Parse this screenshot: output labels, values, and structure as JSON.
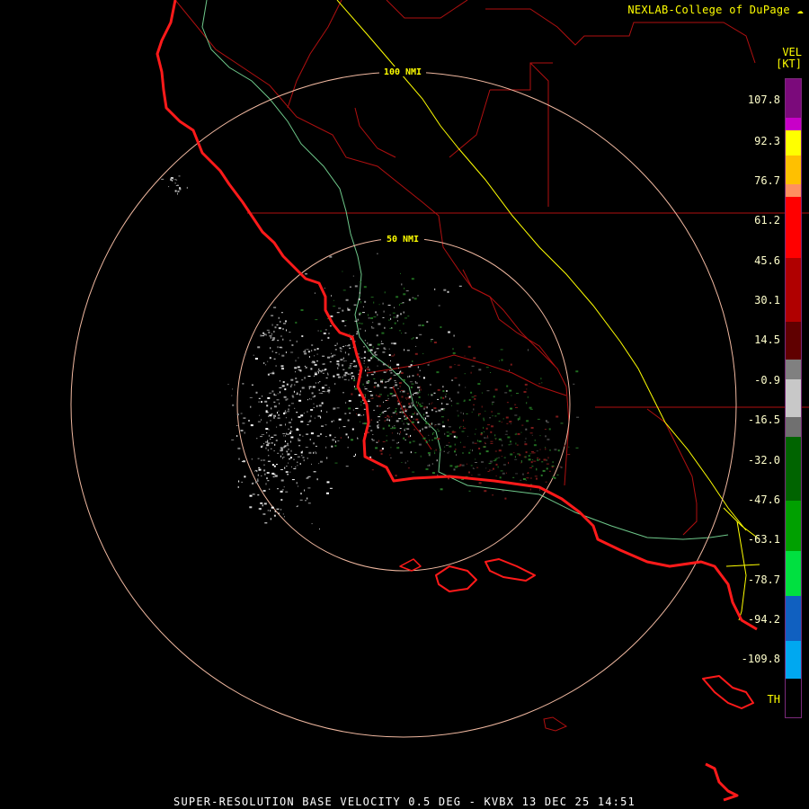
{
  "credit": "NEXLAB-College of DuPage",
  "product_footer": "SUPER-RESOLUTION BASE VELOCITY 0.5 DEG - KVBX 13 DEC 25 14:51",
  "legend": {
    "header_line1": "VEL",
    "header_line2": "[KT]",
    "ticks": [
      "107.8",
      "92.3",
      "76.7",
      "61.2",
      "45.6",
      "30.1",
      "14.5",
      "-0.9",
      "-16.5",
      "-32.0",
      "-47.6",
      "-63.1",
      "-78.7",
      "-94.2",
      "-109.8",
      "TH"
    ],
    "segments": [
      {
        "from": 0.0,
        "to": 0.06,
        "color": "#7b0a7b"
      },
      {
        "from": 0.06,
        "to": 0.08,
        "color": "#c800c8"
      },
      {
        "from": 0.08,
        "to": 0.12,
        "color": "#ffff00"
      },
      {
        "from": 0.12,
        "to": 0.165,
        "color": "#ffc000"
      },
      {
        "from": 0.165,
        "to": 0.185,
        "color": "#ff9060"
      },
      {
        "from": 0.185,
        "to": 0.28,
        "color": "#ff0000"
      },
      {
        "from": 0.28,
        "to": 0.38,
        "color": "#b00000"
      },
      {
        "from": 0.38,
        "to": 0.44,
        "color": "#600000"
      },
      {
        "from": 0.44,
        "to": 0.47,
        "color": "#808080"
      },
      {
        "from": 0.47,
        "to": 0.53,
        "color": "#c8c8c8"
      },
      {
        "from": 0.53,
        "to": 0.56,
        "color": "#707070"
      },
      {
        "from": 0.56,
        "to": 0.66,
        "color": "#006400"
      },
      {
        "from": 0.66,
        "to": 0.74,
        "color": "#00a000"
      },
      {
        "from": 0.74,
        "to": 0.81,
        "color": "#00e040"
      },
      {
        "from": 0.81,
        "to": 0.88,
        "color": "#1060c0"
      },
      {
        "from": 0.88,
        "to": 0.94,
        "color": "#00a8f0"
      },
      {
        "from": 0.94,
        "to": 1.0,
        "color": "#000000"
      }
    ]
  },
  "range_rings": [
    {
      "label": "50 NMI"
    },
    {
      "label": "100 NMI"
    }
  ],
  "colors": {
    "coastline": "#ff1a1a",
    "boundaries": "#b01010",
    "highway_green": "#6ec88a",
    "highway_yellow": "#ffff00",
    "range_ring": "#f0b8a0"
  }
}
